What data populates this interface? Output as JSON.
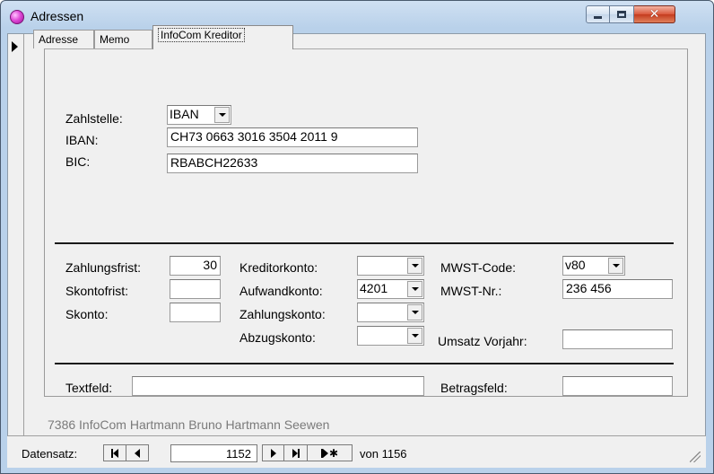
{
  "window": {
    "title": "Adressen"
  },
  "tabs": [
    {
      "label": "Adresse"
    },
    {
      "label": "Memo"
    },
    {
      "label": "InfoCom Kreditor"
    }
  ],
  "payment": {
    "zahlstelle_label": "Zahlstelle:",
    "zahlstelle_value": "IBAN",
    "iban_label": "IBAN:",
    "iban_value": "CH73 0663 3016 3504 2011 9",
    "bic_label": "BIC:",
    "bic_value": "RBABCH22633"
  },
  "terms": {
    "zahlungsfrist_label": "Zahlungsfrist:",
    "zahlungsfrist_value": "30",
    "skontofrist_label": "Skontofrist:",
    "skontofrist_value": "",
    "skonto_label": "Skonto:",
    "skonto_value": ""
  },
  "accounts": {
    "kreditorkonto_label": "Kreditorkonto:",
    "kreditorkonto_value": "",
    "aufwandkonto_label": "Aufwandkonto:",
    "aufwandkonto_value": "4201",
    "zahlungskonto_label": "Zahlungskonto:",
    "zahlungskonto_value": "",
    "abzugskonto_label": "Abzugskonto:",
    "abzugskonto_value": ""
  },
  "vat": {
    "mwst_code_label": "MWST-Code:",
    "mwst_code_value": "v80",
    "mwst_nr_label": "MWST-Nr.:",
    "mwst_nr_value": "236 456",
    "umsatz_label": "Umsatz Vorjahr:",
    "umsatz_value": ""
  },
  "extra": {
    "textfeld_label": "Textfeld:",
    "textfeld_value": "",
    "betragsfeld_label": "Betragsfeld:",
    "betragsfeld_value": ""
  },
  "footer": {
    "record_summary": "7386 InfoCom Hartmann Bruno Hartmann Seewen"
  },
  "navigation": {
    "label": "Datensatz:",
    "current": "1152",
    "of_text": "von 1156"
  },
  "icons": {
    "app": "app-icon",
    "minimize": "minimize-icon",
    "maximize": "maximize-icon",
    "close": "close-icon",
    "record_selector": "record-selector-arrow-icon",
    "dropdown": "chevron-down-icon",
    "first": "first-record-icon",
    "previous": "previous-record-icon",
    "next": "next-record-icon",
    "last": "last-record-icon",
    "new": "new-record-icon",
    "resize": "resize-grip-icon"
  },
  "colors": {
    "titlebar": "#b9d1ea",
    "close_button": "#c43b1e",
    "form_background": "#f0f0f0",
    "footer_text": "#7a7a7a"
  }
}
